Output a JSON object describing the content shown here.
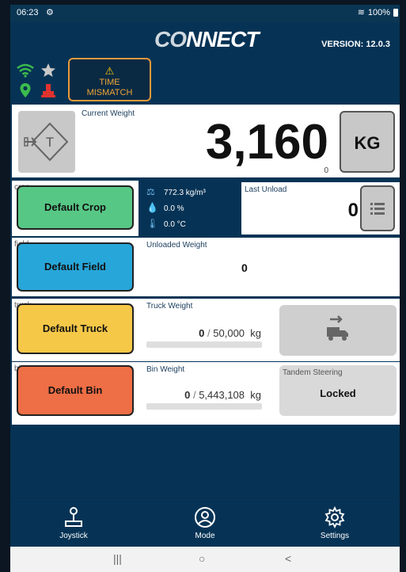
{
  "status_bar": {
    "time": "06:23",
    "settings_glyph": "⚙",
    "wifi_glyph": "≋",
    "battery": "100%"
  },
  "header": {
    "logo_prefix": "CO",
    "logo_suffix": "NNECT",
    "version": "VERSION: 12.0.3"
  },
  "alerts": {
    "time_mismatch": "TIME MISMATCH",
    "warning_glyph": "⚠"
  },
  "weight": {
    "label": "Current Weight",
    "value": "3,160",
    "sub_value": "0",
    "unit": "KG"
  },
  "crop": {
    "tag": "crop",
    "name": "Default Crop",
    "density": "772.3 kg/m³",
    "moisture": "0.0 %",
    "temperature": "0.0 °C"
  },
  "last_unload": {
    "label": "Last Unload",
    "value": "0"
  },
  "field": {
    "tag": "field",
    "name": "Default Field",
    "unloaded_label": "Unloaded Weight",
    "unloaded_value": "0"
  },
  "truck": {
    "tag": "truck",
    "name": "Default Truck",
    "weight_label": "Truck Weight",
    "current": "0",
    "capacity": "50,000",
    "unit": "kg",
    "fill_fraction": 0
  },
  "bin": {
    "tag": "bin",
    "name": "Default Bin",
    "weight_label": "Bin Weight",
    "current": "0",
    "capacity": "5,443,108",
    "unit": "kg",
    "fill_fraction": 0
  },
  "tandem": {
    "label": "Tandem Steering",
    "value": "Locked"
  },
  "nav": {
    "joystick": "Joystick",
    "mode": "Mode",
    "settings": "Settings"
  },
  "android": {
    "recent_glyph": "|||",
    "home_glyph": "○",
    "back_glyph": "<"
  },
  "colors": {
    "background": "#063355",
    "crop": "#57c785",
    "field": "#27a6d9",
    "truck": "#f6c848",
    "bin": "#ee6e45",
    "warning": "#e8993a"
  }
}
